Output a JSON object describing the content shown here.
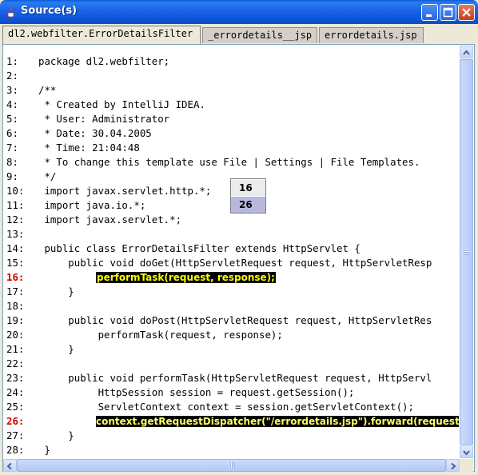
{
  "window": {
    "title": "Source(s)",
    "icon": "java-cup-icon",
    "controls": [
      "minimize-icon",
      "maximize-icon",
      "close-icon"
    ]
  },
  "tabs": [
    {
      "label": "dl2.webfilter.ErrorDetailsFilter",
      "active": true
    },
    {
      "label": "_errordetails__jsp",
      "active": false
    },
    {
      "label": "errordetails.jsp",
      "active": false
    }
  ],
  "lines": [
    {
      "num": "1:",
      "code": "package dl2.webfilter;"
    },
    {
      "num": "2:",
      "code": ""
    },
    {
      "num": "3:",
      "code": "/**"
    },
    {
      "num": "4:",
      "code": " * Created by IntelliJ IDEA."
    },
    {
      "num": "5:",
      "code": " * User: Administrator"
    },
    {
      "num": "6:",
      "code": " * Date: 30.04.2005"
    },
    {
      "num": "7:",
      "code": " * Time: 21:04:48"
    },
    {
      "num": "8:",
      "code": " * To change this template use File | Settings | File Templates."
    },
    {
      "num": "9:",
      "code": " */"
    },
    {
      "num": "10:",
      "code": " import javax.servlet.http.*;"
    },
    {
      "num": "11:",
      "code": " import java.io.*;"
    },
    {
      "num": "12:",
      "code": " import javax.servlet.*;"
    },
    {
      "num": "13:",
      "code": ""
    },
    {
      "num": "14:",
      "code": " public class ErrorDetailsFilter extends HttpServlet {"
    },
    {
      "num": "15:",
      "code": "     public void doGet(HttpServletRequest request, HttpServletResp"
    },
    {
      "num": "16:",
      "code": "performTask(request, response);"
    },
    {
      "num": "17:",
      "code": "     }"
    },
    {
      "num": "18:",
      "code": ""
    },
    {
      "num": "19:",
      "code": "     public void doPost(HttpServletRequest request, HttpServletRes"
    },
    {
      "num": "20:",
      "code": "          performTask(request, response);"
    },
    {
      "num": "21:",
      "code": "     }"
    },
    {
      "num": "22:",
      "code": ""
    },
    {
      "num": "23:",
      "code": "     public void performTask(HttpServletRequest request, HttpServl"
    },
    {
      "num": "24:",
      "code": "          HttpSession session = request.getSession();"
    },
    {
      "num": "25:",
      "code": "          ServletContext context = session.getServletContext();"
    },
    {
      "num": "26:",
      "code": "context.getRequestDispatcher(\"/errordetails.jsp\").forward(request, r"
    },
    {
      "num": "27:",
      "code": "     }"
    },
    {
      "num": "28:",
      "code": " }"
    }
  ],
  "breakpoint_lines": [
    "16:",
    "26:"
  ],
  "popup": {
    "options": [
      "16",
      "26"
    ],
    "selected": "26"
  },
  "colors": {
    "titlebar": "#0b54d6",
    "highlight_bg": "#000000",
    "highlight_fg": "#ffff00",
    "breakpoint_number": "#cc0000",
    "popup_selected": "#b8b8de"
  }
}
